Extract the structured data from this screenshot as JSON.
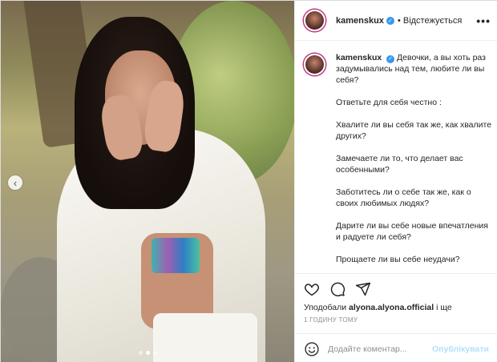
{
  "post": {
    "username": "kamenskux",
    "follow_state": "Відстежується",
    "more_label": "•••",
    "verified_icon": "verified-badge-icon",
    "caption_paragraphs": [
      "Девочки, а вы хоть раз задумывались над тем, любите ли вы себя?",
      "Ответьте для себя честно :",
      "Хвалите ли вы себя так же, как хвалите других?",
      "Замечаете ли то, что делает вас особенными?",
      "Заботитесь ли о себе так же, как о своих любимых людях?",
      "Дарите ли вы себе новые впечатления и радуете ли себя?",
      "Прощаете ли вы себе неудачи?"
    ]
  },
  "carousel": {
    "prev_glyph": "‹",
    "dot_count": 3,
    "active_dot": 1
  },
  "actions": {
    "icons": [
      "heart-icon",
      "comment-icon",
      "share-icon"
    ],
    "likes_prefix": "Уподобали ",
    "liked_by": "alyona.alyona.official",
    "likes_suffix": " і ще",
    "timestamp": "1 ГОДИНУ ТОМУ"
  },
  "comment": {
    "placeholder": "Додайте коментар...",
    "publish_label": "Опублікувати",
    "emoji_icon": "smile-icon"
  },
  "colors": {
    "verified": "#3897f0",
    "publish_disabled": "#b2dffc",
    "border": "#dbdbdb",
    "muted": "#8e8e8e"
  }
}
